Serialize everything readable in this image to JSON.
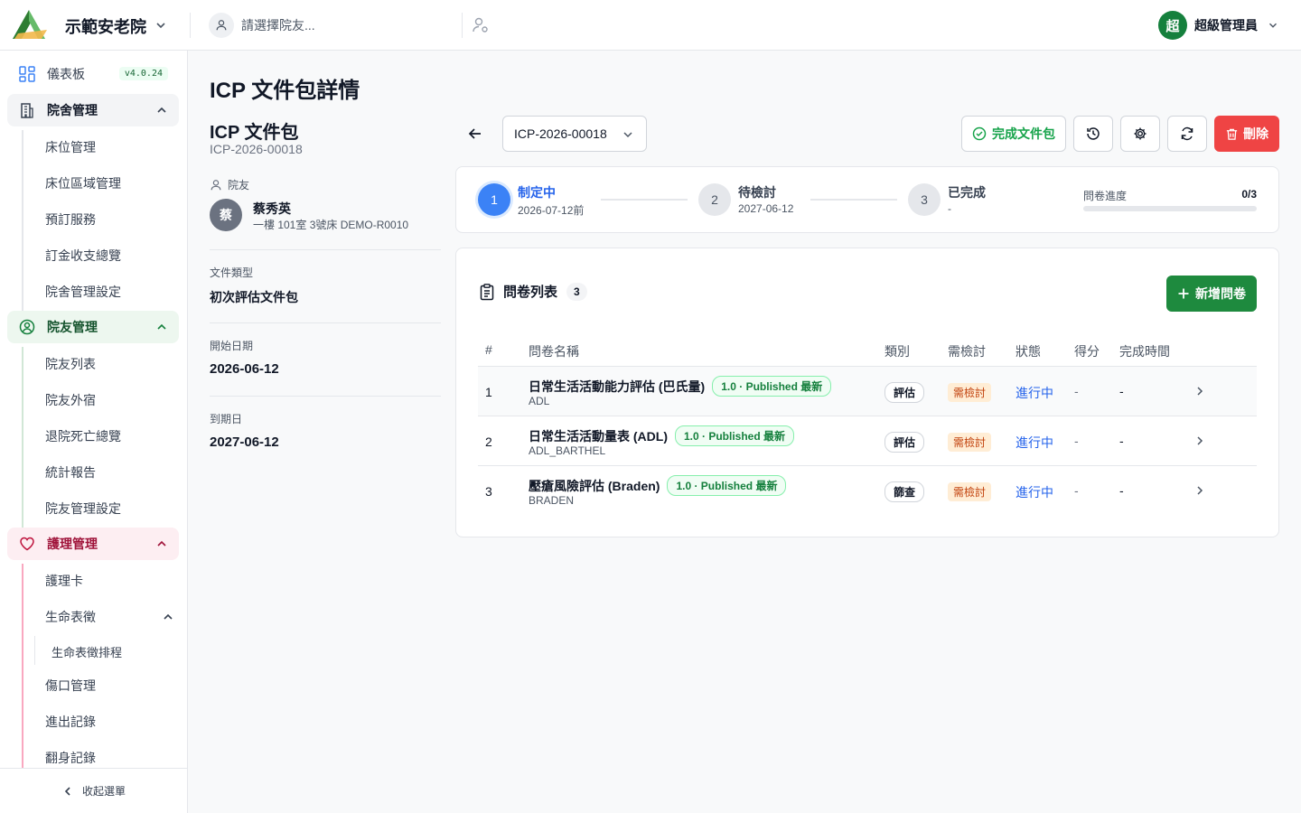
{
  "header": {
    "org_name": "示範安老院",
    "resident_placeholder": "請選擇院友...",
    "user_avatar": "超",
    "user_name": "超級管理員"
  },
  "sidebar": {
    "dashboard": "儀表板",
    "version": "v4.0.24",
    "group1": {
      "label": "院舍管理",
      "items": [
        "床位管理",
        "床位區域管理",
        "預訂服務",
        "訂金收支總覽",
        "院舍管理設定"
      ]
    },
    "group2": {
      "label": "院友管理",
      "items": [
        "院友列表",
        "院友外宿",
        "退院死亡總覽",
        "統計報告",
        "院友管理設定"
      ]
    },
    "group3": {
      "label": "護理管理",
      "items": [
        "護理卡",
        "生命表徵",
        "生命表徵排程",
        "傷口管理",
        "進出記錄",
        "翻身記錄"
      ]
    },
    "collapse": "收起選單"
  },
  "page": {
    "title": "ICP 文件包詳情"
  },
  "package": {
    "title": "ICP 文件包",
    "code": "ICP-2026-00018",
    "resident_label": "院友",
    "resident_avatar": "蔡",
    "resident_name": "蔡秀英",
    "resident_location": "一樓 101室 3號床 DEMO-R0010",
    "doc_type_label": "文件類型",
    "doc_type": "初次評估文件包",
    "start_label": "開始日期",
    "start_date": "2026-06-12",
    "end_label": "到期日",
    "end_date": "2027-06-12"
  },
  "toolbar": {
    "selected_package": "ICP-2026-00018",
    "complete_label": "完成文件包",
    "delete_label": "刪除"
  },
  "steps": [
    {
      "num": "1",
      "title": "制定中",
      "sub": "2026-07-12前"
    },
    {
      "num": "2",
      "title": "待檢討",
      "sub": "2027-06-12"
    },
    {
      "num": "3",
      "title": "已完成",
      "sub": "-"
    }
  ],
  "progress": {
    "label": "問卷進度",
    "value": "0/3",
    "fraction": 0
  },
  "questionnaires": {
    "title": "問卷列表",
    "count": "3",
    "add_label": "新增問卷",
    "columns": [
      "#",
      "問卷名稱",
      "類別",
      "需檢討",
      "狀態",
      "得分",
      "完成時間"
    ],
    "rows": [
      {
        "idx": "1",
        "name": "日常生活活動能力評估 (巴氏量)",
        "version": "1.0 · Published 最新",
        "code": "ADL",
        "category": "評估",
        "review": "需檢討",
        "status": "進行中",
        "score": "-",
        "time": "-"
      },
      {
        "idx": "2",
        "name": "日常生活活動量表 (ADL)",
        "version": "1.0 · Published 最新",
        "code": "ADL_BARTHEL",
        "category": "評估",
        "review": "需檢討",
        "status": "進行中",
        "score": "-",
        "time": "-"
      },
      {
        "idx": "3",
        "name": "壓瘡風險評估 (Braden)",
        "version": "1.0 · Published 最新",
        "code": "BRADEN",
        "category": "篩查",
        "review": "需檢討",
        "status": "進行中",
        "score": "-",
        "time": "-"
      }
    ]
  }
}
